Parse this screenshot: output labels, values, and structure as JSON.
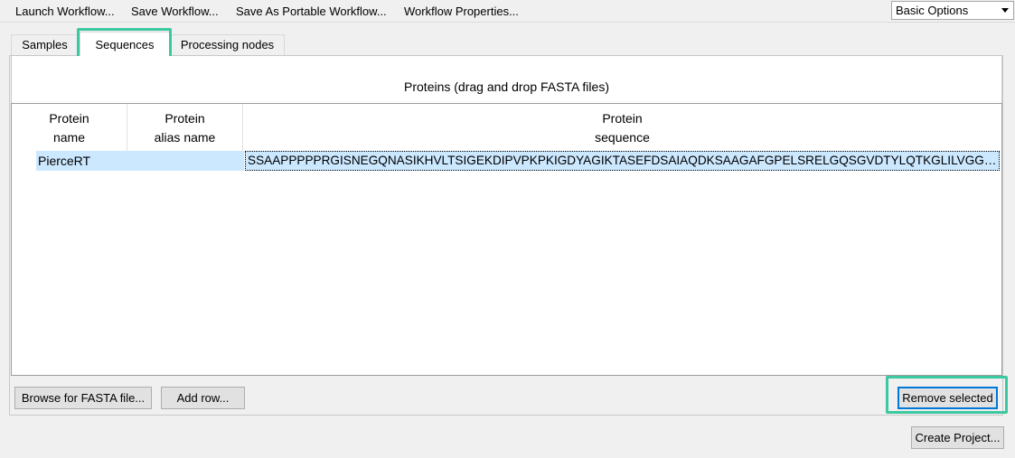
{
  "toolbar": {
    "launch": "Launch Workflow...",
    "save": "Save Workflow...",
    "save_portable": "Save As Portable Workflow...",
    "properties": "Workflow Properties...",
    "options_value": "Basic Options"
  },
  "tabs": [
    {
      "label": "Samples",
      "active": false
    },
    {
      "label": "Sequences",
      "active": true
    },
    {
      "label": "Processing nodes",
      "active": false
    }
  ],
  "panel": {
    "title": "Proteins (drag and drop FASTA files)"
  },
  "table": {
    "columns": [
      {
        "line1": "Protein",
        "line2": "name"
      },
      {
        "line1": "Protein",
        "line2": "alias name"
      },
      {
        "line1": "Protein",
        "line2": "sequence"
      }
    ],
    "rows": [
      {
        "name": "PierceRT",
        "alias": "",
        "sequence": "SSAAPPPPPRGISNEGQNASIKHVLTSIGEKDIPVPKPKIGDYAGIKTASEFDSAIAQDKSAAGAFGPELSRELGQSGVDTYLQTKGLILVGGY..."
      }
    ]
  },
  "buttons": {
    "browse": "Browse for FASTA file...",
    "add_row": "Add row...",
    "remove": "Remove selected",
    "create": "Create Project..."
  },
  "colors": {
    "highlight": "#3cc8a0",
    "selection": "#cce8ff",
    "focus": "#0078d7"
  }
}
